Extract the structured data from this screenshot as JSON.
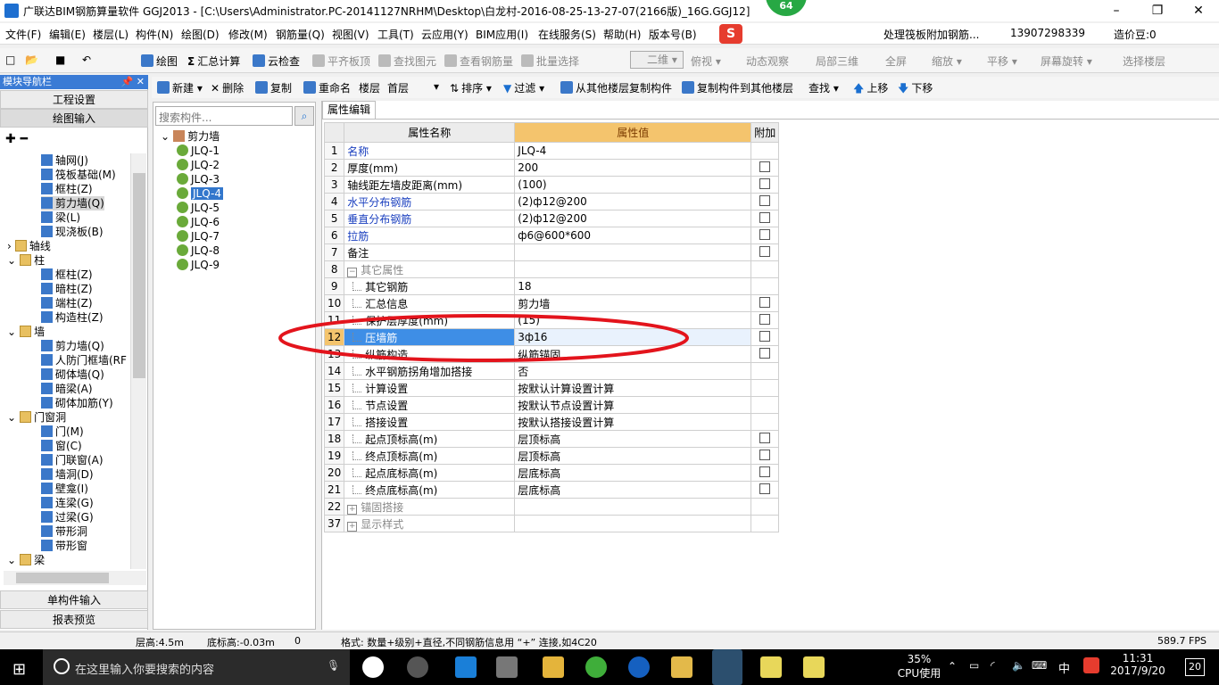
{
  "titlebar": {
    "title": "广联达BIM钢筋算量软件 GGJ2013 - [C:\\Users\\Administrator.PC-20141127NRHM\\Desktop\\白龙村-2016-08-25-13-27-07(2166版)_16G.GGJ12]",
    "badge": "64",
    "minimize": "–",
    "maximize": "❐",
    "close": "✕"
  },
  "menubar": {
    "items": [
      "文件(F)",
      "编辑(E)",
      "楼层(L)",
      "构件(N)",
      "绘图(D)",
      "修改(M)",
      "钢筋量(Q)",
      "视图(V)",
      "工具(T)",
      "云应用(Y)",
      "BIM应用(I)",
      "在线服务(S)",
      "帮助(H)",
      "版本号(B)"
    ],
    "notice": "处理筏板附加钢筋...",
    "phone": "13907298339",
    "coins": "造价豆:0"
  },
  "toolbar": {
    "items": [
      "绘图",
      "汇总计算",
      "云检查",
      "平齐板顶",
      "查找图元",
      "查看钢筋量",
      "批量选择",
      "二维",
      "俯视",
      "动态观察",
      "局部三维",
      "全屏",
      "缩放",
      "平移",
      "屏幕旋转",
      "选择楼层"
    ]
  },
  "leftpanel": {
    "header": "模块导航栏",
    "pin": "📌 ✕",
    "btn_project": "工程设置",
    "btn_draw": "绘图输入",
    "btn_single": "单构件输入",
    "btn_report": "报表预览",
    "tree": [
      {
        "label": "轴网(J)",
        "indent": 2
      },
      {
        "label": "筏板基础(M)",
        "indent": 2
      },
      {
        "label": "框柱(Z)",
        "indent": 2
      },
      {
        "label": "剪力墙(Q)",
        "indent": 2
      },
      {
        "label": "梁(L)",
        "indent": 2
      },
      {
        "label": "现浇板(B)",
        "indent": 2
      },
      {
        "label": "轴线",
        "indent": 1,
        "folder": true
      },
      {
        "label": "柱",
        "indent": 1,
        "folder": true
      },
      {
        "label": "框柱(Z)",
        "indent": 2
      },
      {
        "label": "暗柱(Z)",
        "indent": 2
      },
      {
        "label": "端柱(Z)",
        "indent": 2
      },
      {
        "label": "构造柱(Z)",
        "indent": 2
      },
      {
        "label": "墙",
        "indent": 1,
        "folder": true
      },
      {
        "label": "剪力墙(Q)",
        "indent": 2
      },
      {
        "label": "人防门框墙(RF",
        "indent": 2
      },
      {
        "label": "砌体墙(Q)",
        "indent": 2
      },
      {
        "label": "暗梁(A)",
        "indent": 2
      },
      {
        "label": "砌体加筋(Y)",
        "indent": 2
      },
      {
        "label": "门窗洞",
        "indent": 1,
        "folder": true
      },
      {
        "label": "门(M)",
        "indent": 2
      },
      {
        "label": "窗(C)",
        "indent": 2
      },
      {
        "label": "门联窗(A)",
        "indent": 2
      },
      {
        "label": "墙洞(D)",
        "indent": 2
      },
      {
        "label": "壁龛(I)",
        "indent": 2
      },
      {
        "label": "连梁(G)",
        "indent": 2
      },
      {
        "label": "过梁(G)",
        "indent": 2
      },
      {
        "label": "带形洞",
        "indent": 2
      },
      {
        "label": "带形窗",
        "indent": 2
      },
      {
        "label": "梁",
        "indent": 1,
        "folder": true
      }
    ]
  },
  "comptb": {
    "new": "新建",
    "delete": "删除",
    "copy": "复制",
    "rename": "重命名",
    "floor_label": "楼层",
    "floor_value": "首层",
    "sort": "排序",
    "filter": "过滤",
    "copy_from": "从其他楼层复制构件",
    "copy_to": "复制构件到其他楼层",
    "find": "查找",
    "up": "上移",
    "down": "下移"
  },
  "midpanel": {
    "search_placeholder": "搜索构件...",
    "root": "剪力墙",
    "items": [
      "JLQ-1",
      "JLQ-2",
      "JLQ-3",
      "JLQ-4",
      "JLQ-5",
      "JLQ-6",
      "JLQ-7",
      "JLQ-8",
      "JLQ-9"
    ],
    "selected_index": 3
  },
  "props": {
    "tab": "属性编辑",
    "col_name": "属性名称",
    "col_value": "属性值",
    "col_extra": "附加",
    "rows": [
      {
        "n": "1",
        "name": "名称",
        "value": "JLQ-4",
        "blue": true,
        "chk": false
      },
      {
        "n": "2",
        "name": "厚度(mm)",
        "value": "200",
        "chk": true
      },
      {
        "n": "3",
        "name": "轴线距左墙皮距离(mm)",
        "value": "(100)",
        "chk": true
      },
      {
        "n": "4",
        "name": "水平分布钢筋",
        "value": "(2)ф12@200",
        "blue": true,
        "chk": true
      },
      {
        "n": "5",
        "name": "垂直分布钢筋",
        "value": "(2)ф12@200",
        "blue": true,
        "chk": true
      },
      {
        "n": "6",
        "name": "拉筋",
        "value": "ф6@600*600",
        "blue": true,
        "chk": true
      },
      {
        "n": "7",
        "name": "备注",
        "value": "",
        "chk": true
      },
      {
        "n": "8",
        "name": "其它属性",
        "value": "",
        "group": true,
        "sign": "−"
      },
      {
        "n": "9",
        "name": "其它钢筋",
        "value": "18",
        "sub": true
      },
      {
        "n": "10",
        "name": "汇总信息",
        "value": "剪力墙",
        "sub": true,
        "chk": true
      },
      {
        "n": "11",
        "name": "保护层厚度(mm)",
        "value": "(15)",
        "sub": true,
        "chk": true
      },
      {
        "n": "12",
        "name": "压墙筋",
        "value": "3ф16",
        "sub": true,
        "chk": true,
        "selected": true
      },
      {
        "n": "13",
        "name": "纵筋构造",
        "value": "纵筋锚固",
        "sub": true,
        "chk": true
      },
      {
        "n": "14",
        "name": "水平钢筋拐角增加搭接",
        "value": "否",
        "sub": true
      },
      {
        "n": "15",
        "name": "计算设置",
        "value": "按默认计算设置计算",
        "sub": true
      },
      {
        "n": "16",
        "name": "节点设置",
        "value": "按默认节点设置计算",
        "sub": true
      },
      {
        "n": "17",
        "name": "搭接设置",
        "value": "按默认搭接设置计算",
        "sub": true
      },
      {
        "n": "18",
        "name": "起点顶标高(m)",
        "value": "层顶标高",
        "sub": true,
        "chk": true
      },
      {
        "n": "19",
        "name": "终点顶标高(m)",
        "value": "层顶标高",
        "sub": true,
        "chk": true
      },
      {
        "n": "20",
        "name": "起点底标高(m)",
        "value": "层底标高",
        "sub": true,
        "chk": true
      },
      {
        "n": "21",
        "name": "终点底标高(m)",
        "value": "层底标高",
        "sub": true,
        "chk": true
      },
      {
        "n": "22",
        "name": "锚固搭接",
        "value": "",
        "group": true,
        "sign": "+"
      },
      {
        "n": "37",
        "name": "显示样式",
        "value": "",
        "group": true,
        "sign": "+"
      }
    ]
  },
  "statusbar": {
    "floor_height": "层高:4.5m",
    "bottom_elev": "底标高:-0.03m",
    "zero": "0",
    "format_hint": "格式: 数量+级别+直径,不同钢筋信息用 “+” 连接,如4C20",
    "fps": "589.7 FPS"
  },
  "taskbar": {
    "search_placeholder": "在这里输入你要搜索的内容",
    "cpu_percent": "35%",
    "cpu_label": "CPU使用",
    "ime": "中",
    "time": "11:31",
    "date": "2017/9/20",
    "notif": "20"
  }
}
